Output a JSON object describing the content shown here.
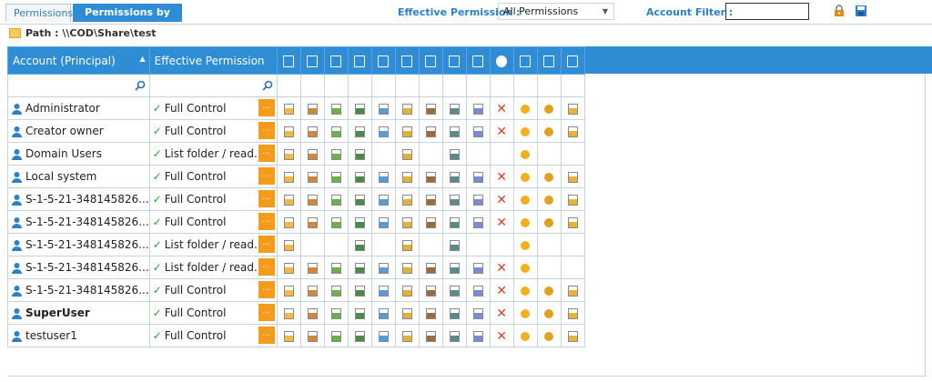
{
  "tabs": [
    {
      "label": "Permissions"
    },
    {
      "label": "Permissions by User"
    }
  ],
  "toolbar": {
    "effective_label": "Effective Permission :",
    "effective_value": "All Permissions",
    "account_filter_label": "Account Filter :",
    "account_filter_value": ""
  },
  "path": {
    "label": "Path : \\\\COD\\Share\\test"
  },
  "grid": {
    "col_account": "Account (Principal)",
    "col_effective": "Effective Permission",
    "perm_icons": [
      "traverse-folder-icon",
      "list-folder-icon",
      "read-attributes-icon",
      "read-extended-attributes-icon",
      "create-files-icon",
      "create-folders-icon",
      "write-attributes-icon",
      "write-extended-attributes-icon",
      "delete-subfolders-icon",
      "delete-icon",
      "read-permissions-icon",
      "change-permissions-icon",
      "take-ownership-icon"
    ],
    "cell_icon_colors": [
      "#f3b84a",
      "#d0873a",
      "#6bb04a",
      "#4a8a4a",
      "#5b9bd5",
      "#e0b23a",
      "#9a6b3c",
      "#5b8a8a",
      "#7a8bd5",
      "#d9412a",
      "#f0b020",
      "#e0a020",
      "#e8b33b"
    ],
    "dots_label": "...",
    "rows": [
      {
        "account": "Administrator",
        "effective": "Full Control",
        "bold": false,
        "perms": [
          1,
          1,
          1,
          1,
          1,
          1,
          1,
          1,
          1,
          1,
          1,
          1,
          1
        ]
      },
      {
        "account": "Creator owner",
        "effective": "Full Control",
        "bold": false,
        "perms": [
          1,
          1,
          1,
          1,
          1,
          1,
          1,
          1,
          1,
          1,
          1,
          1,
          1
        ]
      },
      {
        "account": "Domain Users",
        "effective": "List folder / read...",
        "bold": false,
        "perms": [
          1,
          1,
          1,
          1,
          0,
          1,
          0,
          1,
          0,
          0,
          1,
          0,
          0
        ]
      },
      {
        "account": "Local system",
        "effective": "Full Control",
        "bold": false,
        "perms": [
          1,
          1,
          1,
          1,
          1,
          1,
          1,
          1,
          1,
          1,
          1,
          1,
          1
        ]
      },
      {
        "account": "S-1-5-21-348145826...",
        "effective": "Full Control",
        "bold": false,
        "perms": [
          1,
          1,
          1,
          1,
          1,
          1,
          1,
          1,
          1,
          1,
          1,
          1,
          1
        ]
      },
      {
        "account": "S-1-5-21-348145826...",
        "effective": "Full Control",
        "bold": false,
        "perms": [
          1,
          1,
          1,
          1,
          1,
          1,
          1,
          1,
          1,
          1,
          1,
          1,
          1
        ]
      },
      {
        "account": "S-1-5-21-348145826...",
        "effective": "List folder / read...",
        "bold": false,
        "perms": [
          1,
          0,
          0,
          1,
          0,
          1,
          0,
          1,
          0,
          0,
          1,
          0,
          0
        ]
      },
      {
        "account": "S-1-5-21-348145826...",
        "effective": "List folder / read...",
        "bold": false,
        "perms": [
          1,
          1,
          1,
          1,
          1,
          1,
          1,
          1,
          1,
          1,
          1,
          0,
          0
        ]
      },
      {
        "account": "S-1-5-21-348145826...",
        "effective": "Full Control",
        "bold": false,
        "perms": [
          1,
          1,
          1,
          1,
          1,
          1,
          1,
          1,
          1,
          1,
          1,
          1,
          1
        ]
      },
      {
        "account": "SuperUser",
        "effective": "Full Control",
        "bold": true,
        "perms": [
          1,
          1,
          1,
          1,
          1,
          1,
          1,
          1,
          1,
          1,
          1,
          1,
          1
        ]
      },
      {
        "account": "testuser1",
        "effective": "Full Control",
        "bold": false,
        "perms": [
          1,
          1,
          1,
          1,
          1,
          1,
          1,
          1,
          1,
          1,
          1,
          1,
          1
        ]
      }
    ]
  },
  "colors": {
    "accent": "#2e8dd5",
    "orange": "#f59b1c",
    "check": "#2aa136"
  }
}
